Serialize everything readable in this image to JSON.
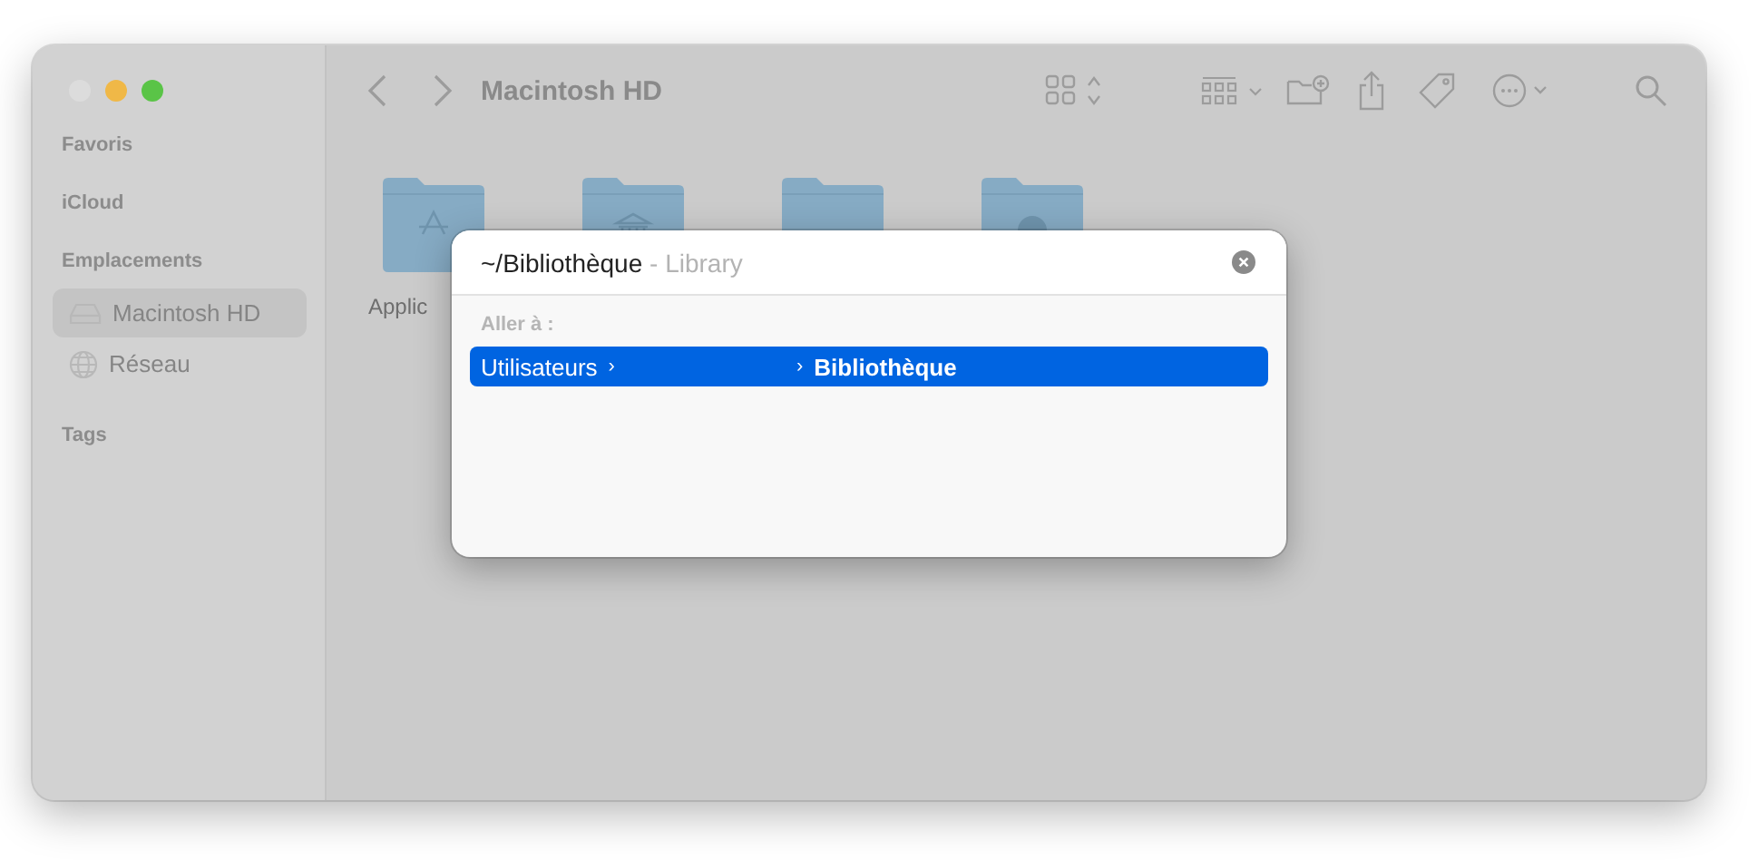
{
  "window": {
    "traffic_lights": [
      {
        "color": "#dcdcdc"
      },
      {
        "color": "#f0b847"
      },
      {
        "color": "#5ac447"
      }
    ]
  },
  "sidebar": {
    "sections": [
      {
        "title": "Favoris"
      },
      {
        "title": "iCloud"
      },
      {
        "title": "Emplacements",
        "items": [
          {
            "label": "Macintosh HD",
            "kind": "disk",
            "selected": true
          },
          {
            "label": "Réseau",
            "kind": "network",
            "selected": false
          }
        ]
      },
      {
        "title": "Tags"
      }
    ]
  },
  "toolbar": {
    "title": "Macintosh HD"
  },
  "folders": [
    {
      "label": "Applic",
      "kind": "apps"
    },
    {
      "kind": "library"
    },
    {
      "kind": "system"
    },
    {
      "kind": "user"
    }
  ],
  "dialog": {
    "query": "~/Bibliothèque",
    "hint": "- Library",
    "section": "Aller à :",
    "results": [
      {
        "selected": true,
        "segments": [
          {
            "kind": "name",
            "text": "Utilisateurs"
          },
          {
            "kind": "separator",
            "text": "›"
          },
          {
            "kind": "blank"
          },
          {
            "kind": "separator",
            "text": "›"
          },
          {
            "kind": "current",
            "text": "Bibliothèque"
          }
        ]
      }
    ]
  }
}
